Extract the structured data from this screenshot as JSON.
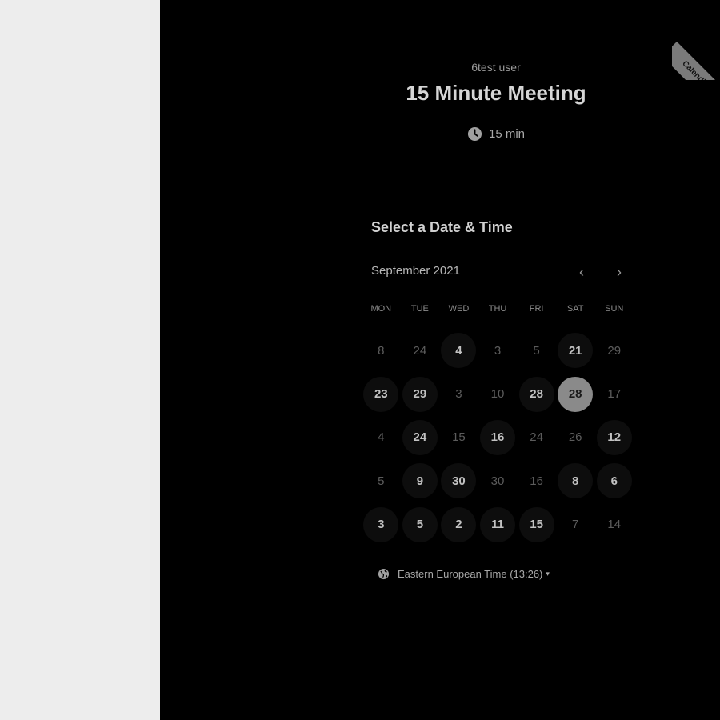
{
  "event": {
    "host": "6test user",
    "title": "15 Minute Meeting",
    "duration": "15 min"
  },
  "calendar": {
    "section_title": "Select a Date & Time",
    "month": "September 2021",
    "prev_label": "‹",
    "next_label": "›",
    "weekdays": [
      "MON",
      "TUE",
      "WED",
      "THU",
      "FRI",
      "SAT",
      "SUN"
    ],
    "weeks": [
      [
        {
          "d": "8",
          "s": "unavailable"
        },
        {
          "d": "24",
          "s": "unavailable"
        },
        {
          "d": "4",
          "s": "available"
        },
        {
          "d": "3",
          "s": "unavailable"
        },
        {
          "d": "5",
          "s": "unavailable"
        },
        {
          "d": "21",
          "s": "available"
        },
        {
          "d": "29",
          "s": "unavailable"
        }
      ],
      [
        {
          "d": "23",
          "s": "available"
        },
        {
          "d": "29",
          "s": "available"
        },
        {
          "d": "3",
          "s": "unavailable"
        },
        {
          "d": "10",
          "s": "unavailable"
        },
        {
          "d": "28",
          "s": "available"
        },
        {
          "d": "28",
          "s": "selected"
        },
        {
          "d": "17",
          "s": "unavailable"
        }
      ],
      [
        {
          "d": "4",
          "s": "unavailable"
        },
        {
          "d": "24",
          "s": "available"
        },
        {
          "d": "15",
          "s": "unavailable"
        },
        {
          "d": "16",
          "s": "available"
        },
        {
          "d": "24",
          "s": "unavailable"
        },
        {
          "d": "26",
          "s": "unavailable"
        },
        {
          "d": "12",
          "s": "available"
        }
      ],
      [
        {
          "d": "5",
          "s": "unavailable"
        },
        {
          "d": "9",
          "s": "available"
        },
        {
          "d": "30",
          "s": "available"
        },
        {
          "d": "30",
          "s": "unavailable"
        },
        {
          "d": "16",
          "s": "unavailable"
        },
        {
          "d": "8",
          "s": "available"
        },
        {
          "d": "6",
          "s": "available"
        }
      ],
      [
        {
          "d": "3",
          "s": "available"
        },
        {
          "d": "5",
          "s": "available"
        },
        {
          "d": "2",
          "s": "available"
        },
        {
          "d": "11",
          "s": "available"
        },
        {
          "d": "15",
          "s": "available"
        },
        {
          "d": "7",
          "s": "unavailable"
        },
        {
          "d": "14",
          "s": "unavailable"
        }
      ]
    ]
  },
  "timezone": {
    "label": "Eastern European Time (13:26)",
    "caret": "▾"
  },
  "ribbon": {
    "text": "Calendly"
  },
  "colors": {
    "background": "#000000",
    "side_panel": "#ededed",
    "selected_day": "#8a8a8a"
  },
  "icons": [
    "clock-icon",
    "globe-icon",
    "chevron-left-icon",
    "chevron-right-icon",
    "caret-down-icon"
  ]
}
